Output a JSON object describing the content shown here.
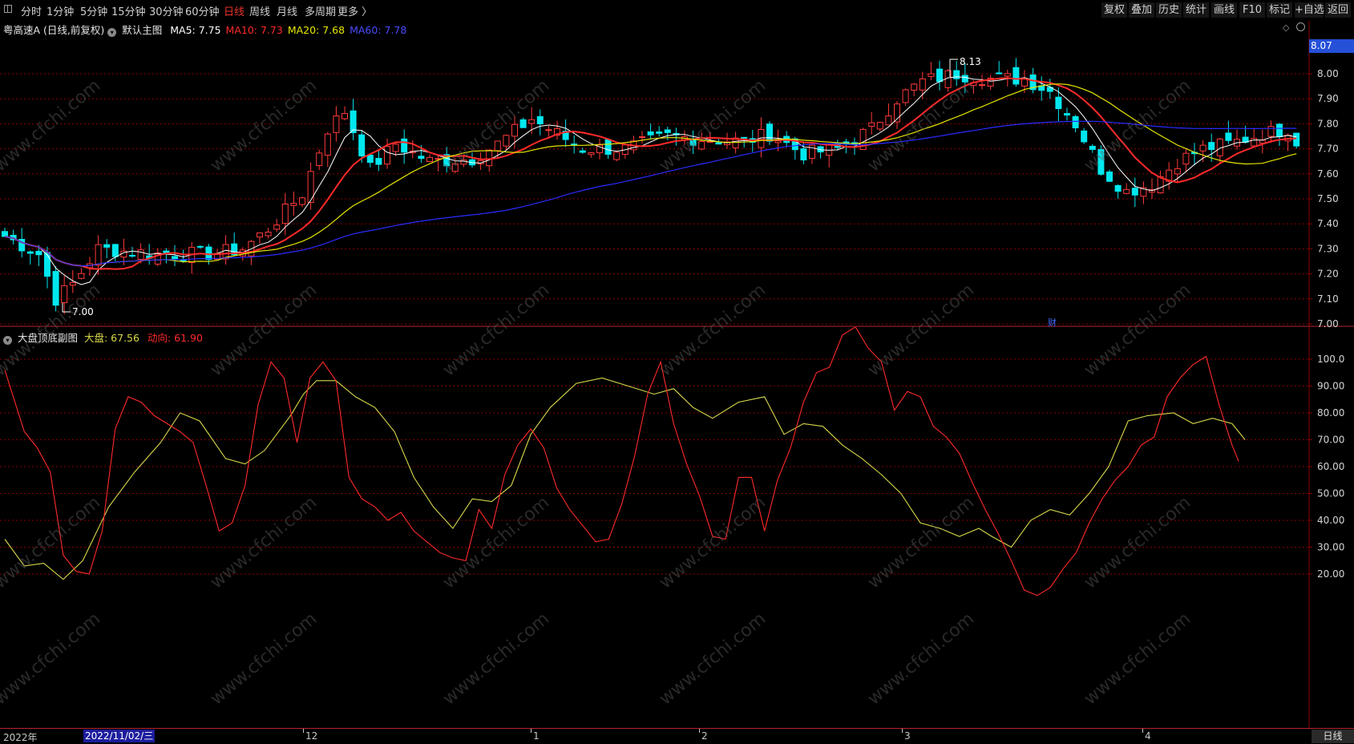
{
  "toolbar": {
    "left": [
      "分时",
      "1分钟",
      "5分钟",
      "15分钟",
      "30分钟",
      "60分钟",
      "日线",
      "周线",
      "月线",
      "多周期",
      "更多 〉"
    ],
    "active": "日线",
    "right": [
      "复权",
      "叠加",
      "历史",
      "统计",
      "画线",
      "F10",
      "标记",
      "+自选",
      "返回"
    ]
  },
  "main": {
    "stock": "粤高速A (日线,前复权)",
    "template": "默认主图",
    "ma": [
      {
        "label": "MA5: 7.75",
        "color": "#ffffff"
      },
      {
        "label": "MA10: 7.73",
        "color": "#ff2a2a"
      },
      {
        "label": "MA20: 7.68",
        "color": "#e6e600"
      },
      {
        "label": "MA60: 7.78",
        "color": "#3a3aff"
      }
    ],
    "price_axis": [
      "8.00",
      "7.90",
      "7.80",
      "7.70",
      "7.60",
      "7.50",
      "7.40",
      "7.30",
      "7.20",
      "7.10",
      "7.00"
    ],
    "price_min": 7.0,
    "price_max": 8.0,
    "current_price": "8.07",
    "high_label": "8.13",
    "low_label": "7.00",
    "event_marker": "财"
  },
  "sub": {
    "title": "大盘顶底副图",
    "dapan": "大盘: 67.56",
    "dongxiang": "动向: 61.90",
    "axis": [
      "100.0",
      "90.00",
      "80.00",
      "70.00",
      "60.00",
      "50.00",
      "40.00",
      "30.00",
      "20.00"
    ],
    "axis_min": 20,
    "axis_max": 100
  },
  "dates": {
    "labels": [
      "2022年",
      "12",
      "1",
      "2",
      "3",
      "4"
    ],
    "cursor": "2022/11/02/三",
    "period": "日线"
  },
  "watermark": "www.cfchi.com",
  "colors": {
    "up": "#ff3a3a",
    "down": "#00e8ef",
    "grid": "#8a0000",
    "dapan_line": "#d8d84a",
    "dongxiang_line": "#ff2a2a"
  }
}
